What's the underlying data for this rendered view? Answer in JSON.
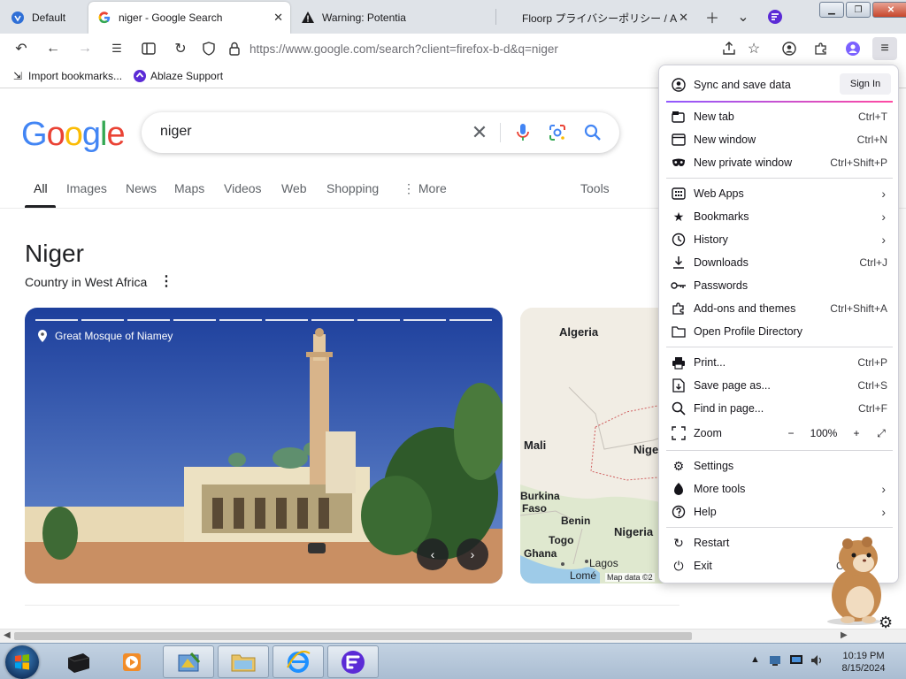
{
  "browser": {
    "tabs": [
      {
        "title": "Default",
        "icon": "ablaze-icon"
      },
      {
        "title": "niger - Google Search",
        "icon": "google-icon",
        "active": true
      },
      {
        "title": "Warning: Potentia",
        "icon": "warning-icon"
      },
      {
        "title": "Floorp プライバシーポリシー / A",
        "icon": "floorp-icon"
      }
    ],
    "url": "https://www.google.com/search?client=firefox-b-d&q=niger",
    "bookmarks": [
      {
        "label": "Import bookmarks...",
        "icon": "import-icon"
      },
      {
        "label": "Ablaze Support",
        "icon": "ablaze-icon"
      }
    ]
  },
  "google": {
    "logo": "Google",
    "query": "niger",
    "tabs": [
      "All",
      "Images",
      "News",
      "Maps",
      "Videos",
      "Web",
      "Shopping",
      "More"
    ],
    "tools": "Tools",
    "more_glyph": "⋮",
    "kp_title": "Niger",
    "kp_subtitle": "Country in West Africa",
    "photo_caption": "Great Mosque of Niamey",
    "map_labels": [
      "Algeria",
      "Mali",
      "Nige",
      "Burkina",
      "Faso",
      "Benin",
      "Togo",
      "Nigeria",
      "Ghana",
      "Lagos",
      "Lomé"
    ],
    "map_data": "Map data ©2"
  },
  "menu": {
    "sync_label": "Sync and save data",
    "sign_in": "Sign In",
    "items": [
      {
        "label": "New tab",
        "shortcut": "Ctrl+T",
        "icon": "new-tab-icon"
      },
      {
        "label": "New window",
        "shortcut": "Ctrl+N",
        "icon": "new-window-icon"
      },
      {
        "label": "New private window",
        "shortcut": "Ctrl+Shift+P",
        "icon": "private-mask-icon"
      },
      {
        "label": "Web Apps",
        "icon": "web-apps-icon"
      },
      {
        "label": "Bookmarks",
        "icon": "star-icon"
      },
      {
        "label": "History",
        "icon": "clock-icon"
      },
      {
        "label": "Downloads",
        "shortcut": "Ctrl+J",
        "icon": "download-icon"
      },
      {
        "label": "Passwords",
        "icon": "key-icon"
      },
      {
        "label": "Add-ons and themes",
        "shortcut": "Ctrl+Shift+A",
        "icon": "puzzle-icon"
      },
      {
        "label": "Open Profile Directory",
        "icon": "folder-icon"
      },
      {
        "label": "Print...",
        "shortcut": "Ctrl+P",
        "icon": "printer-icon"
      },
      {
        "label": "Save page as...",
        "shortcut": "Ctrl+S",
        "icon": "save-page-icon"
      },
      {
        "label": "Find in page...",
        "shortcut": "Ctrl+F",
        "icon": "search-icon"
      },
      {
        "label": "Zoom",
        "icon": "zoom-icon"
      },
      {
        "label": "Settings",
        "icon": "gear-icon"
      },
      {
        "label": "More tools",
        "icon": "tools-icon"
      },
      {
        "label": "Help",
        "icon": "help-icon"
      },
      {
        "label": "Restart",
        "icon": "restart-icon"
      },
      {
        "label": "Exit",
        "shortcut": "Ct",
        "icon": "power-icon"
      }
    ],
    "zoom": {
      "minus": "−",
      "level": "100%",
      "plus": "+"
    }
  },
  "taskbar": {
    "time": "10:19 PM",
    "date": "8/15/2024"
  },
  "colors": {
    "accent_blue": "#0060df",
    "google_blue": "#4285f4",
    "google_red": "#ea4335",
    "google_yellow": "#fbbc05",
    "google_green": "#34a853",
    "sync_gradient_start": "#9059ff",
    "sync_gradient_end": "#ff4aa2"
  }
}
